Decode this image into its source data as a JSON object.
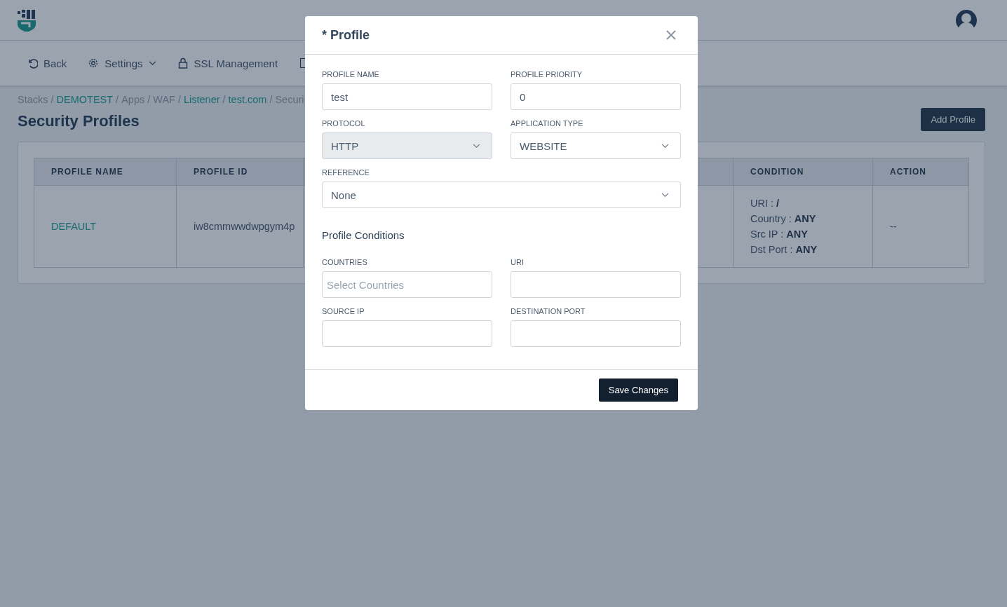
{
  "header": {
    "nav": [
      {
        "label": "Back",
        "dropdown": false
      },
      {
        "label": "Settings",
        "dropdown": true
      },
      {
        "label": "SSL Management",
        "dropdown": false
      }
    ]
  },
  "breadcrumb": [
    {
      "label": "Stacks",
      "kind": "text"
    },
    {
      "label": "/",
      "kind": "separator"
    },
    {
      "label": "DEMOTEST",
      "kind": "link"
    },
    {
      "label": "/",
      "kind": "separator"
    },
    {
      "label": "Apps",
      "kind": "text"
    },
    {
      "label": "/",
      "kind": "separator"
    },
    {
      "label": "WAF",
      "kind": "text"
    },
    {
      "label": "/",
      "kind": "separator"
    },
    {
      "label": "Listener",
      "kind": "link"
    },
    {
      "label": "/",
      "kind": "separator"
    },
    {
      "label": "test.com",
      "kind": "link"
    },
    {
      "label": "/",
      "kind": "separator"
    },
    {
      "label": "Securi",
      "kind": "text"
    }
  ],
  "page_title": "Security Profiles",
  "add_button": "Add Profile",
  "table": {
    "columns": [
      {
        "label": "PROFILE NAME",
        "kind": "name"
      },
      {
        "label": "PROFILE ID",
        "kind": "id"
      },
      {
        "label": "CONDITION",
        "kind": "condition"
      },
      {
        "label": "ACTION",
        "kind": "action"
      }
    ],
    "rows": [
      {
        "profile_name": "DEFAULT",
        "profile_id": "iw8cmmwwdwpgym4p",
        "condition": [
          "URI : **/**",
          "Country : **ANY**",
          "Src IP : **ANY**",
          "Dst Port : **ANY**"
        ],
        "action": "--"
      }
    ]
  },
  "modal": {
    "title": "* Profile",
    "fields": [
      {
        "label": "PROFILE NAME",
        "kind": "text",
        "value": "test",
        "disabled": false
      },
      {
        "label": "PROFILE PRIORITY",
        "kind": "text",
        "value": "0",
        "disabled": false
      },
      {
        "label": "PROTOCOL",
        "kind": "select",
        "value": "HTTP",
        "disabled": true
      },
      {
        "label": "APPLICATION TYPE",
        "kind": "select",
        "value": "WEBSITE",
        "disabled": false
      },
      {
        "label": "REFERENCE",
        "kind": "select",
        "value": "None",
        "disabled": false
      }
    ],
    "section": "Profile Conditions",
    "conditions": [
      {
        "label": "COUNTRIES",
        "kind": "text",
        "placeholder": "Select Countries"
      },
      {
        "label": "URI",
        "kind": "text"
      },
      {
        "label": "SOURCE IP",
        "kind": "text"
      },
      {
        "label": "DESTINATION PORT",
        "kind": "text"
      }
    ],
    "save_button": "Save Changes"
  }
}
